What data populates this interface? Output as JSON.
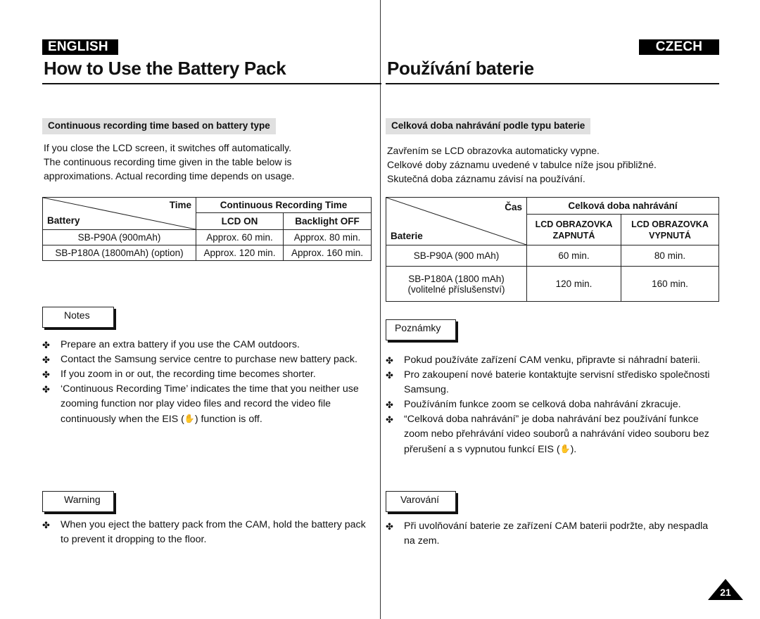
{
  "english": {
    "lang_label": "ENGLISH",
    "title": "How to Use the Battery Pack",
    "section_head": "Continuous recording time based on battery type",
    "intro": [
      "If you close the LCD screen, it switches off automatically.",
      "The continuous recording time given in the table below is",
      "approximations. Actual recording time depends on usage."
    ],
    "table": {
      "corner_top": "Time",
      "corner_bottom": "Battery",
      "group_header": "Continuous Recording Time",
      "col_headers": [
        "LCD ON",
        "Backlight OFF"
      ],
      "rows": [
        {
          "battery": "SB-P90A (900mAh)",
          "values": [
            "Approx. 60 min.",
            "Approx. 80 min."
          ]
        },
        {
          "battery": "SB-P180A (1800mAh) (option)",
          "values": [
            "Approx. 120 min.",
            "Approx. 160 min."
          ]
        }
      ]
    },
    "notes_label": "Notes",
    "notes": [
      "Prepare an extra battery if you use the CAM outdoors.",
      "Contact the Samsung service centre to purchase new battery pack.",
      "If you zoom in or out, the recording time becomes shorter.",
      {
        "before": "‘Continuous Recording Time’ indicates the time that you neither use zooming function nor play video files and record the video file continuously when the EIS (",
        "icon": "eis-hand-icon",
        "after": ") function is off."
      }
    ],
    "warning_label": "Warning",
    "warnings": [
      "When you eject the battery pack from the CAM, hold the battery pack to prevent it dropping to the floor."
    ]
  },
  "czech": {
    "lang_label": "CZECH",
    "title": "Používání baterie",
    "section_head": "Celková doba nahrávání podle typu baterie",
    "intro": [
      "Zavřením se LCD obrazovka automaticky vypne.",
      "Celkové doby záznamu uvedené v tabulce níže jsou přibližné.",
      "Skutečná doba záznamu závisí na používání."
    ],
    "table": {
      "corner_top": "Čas",
      "corner_bottom": "Baterie",
      "group_header": "Celková doba nahrávání",
      "col_headers": [
        "LCD OBRAZOVKA ZAPNUTÁ",
        "LCD OBRAZOVKA VYPNUTÁ"
      ],
      "col_headers_lines": [
        [
          "LCD OBRAZOVKA",
          "ZAPNUTÁ"
        ],
        [
          "LCD OBRAZOVKA",
          "VYPNUTÁ"
        ]
      ],
      "rows": [
        {
          "battery": "SB-P90A (900 mAh)",
          "battery_note": "",
          "values": [
            "60 min.",
            "80 min."
          ]
        },
        {
          "battery": "SB-P180A (1800 mAh)",
          "battery_note": "(volitelné příslušenství)",
          "values": [
            "120 min.",
            "160 min."
          ]
        }
      ]
    },
    "notes_label": "Poznámky",
    "notes": [
      "Pokud používáte zařízení CAM venku, připravte si náhradní baterii.",
      "Pro zakoupení nové baterie kontaktujte servisní středisko společnosti Samsung.",
      "Používáním funkce zoom se celková doba nahrávání zkracuje.",
      {
        "before": "“Celková doba nahrávání” je doba nahrávání bez používání funkce zoom nebo přehrávání video souborů a nahrávání video souboru bez přerušení a s vypnutou funkcí EIS (",
        "icon": "eis-hand-icon",
        "after": ")."
      }
    ],
    "warning_label": "Varování",
    "warnings": [
      "Při uvolňování baterie ze zařízení CAM baterii podržte, aby nespadla na zem."
    ]
  },
  "bullet_glyph": "✤",
  "eis_glyph": "✋",
  "page_number": "21"
}
